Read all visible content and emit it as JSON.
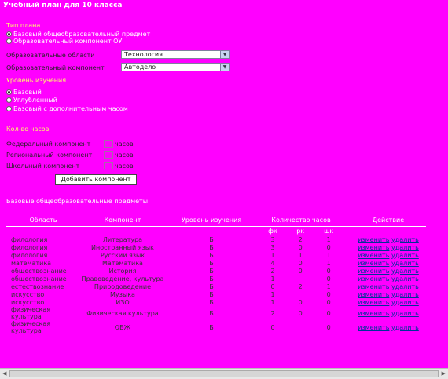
{
  "page": {
    "title": "Учебный план для 10 класса"
  },
  "plan_type": {
    "heading": "Тип плана",
    "options": [
      {
        "label": "Базовый общеобразовательный предмет",
        "selected": true
      },
      {
        "label": "Образовательный компонент ОУ",
        "selected": false
      }
    ]
  },
  "area_field": {
    "label": "Образовательные области",
    "value": "Технология"
  },
  "component_field": {
    "label": "Образовательный компонент",
    "value": "Автодело"
  },
  "study_level": {
    "heading": "Уровень изучения",
    "options": [
      {
        "label": "Базовый",
        "selected": true
      },
      {
        "label": "Углубленный",
        "selected": false
      },
      {
        "label": "Базовый с дополнительным часом",
        "selected": false
      }
    ]
  },
  "hours": {
    "heading": "Кол-во часов",
    "rows": [
      {
        "label": "Федеральный компонент",
        "unit": "часов"
      },
      {
        "label": "Региональный компонент",
        "unit": "часов"
      },
      {
        "label": "Школьный компонент",
        "unit": "часов"
      }
    ],
    "add_button": "Добавить компонент"
  },
  "table": {
    "heading": "Базовые общеобразовательные предметы",
    "columns": [
      "Область",
      "Компонент",
      "Уровень изучения",
      "Количество часов",
      "Действие"
    ],
    "sub_columns": [
      "фк",
      "рк",
      "шк"
    ],
    "edit_label": "изменить",
    "delete_label": "удалить",
    "rows": [
      {
        "area": "филология",
        "component": "Литература",
        "level": "Б",
        "fk": "3",
        "rk": "2",
        "shk": "1"
      },
      {
        "area": "филология",
        "component": "Иностранный язык",
        "level": "Б",
        "fk": "3",
        "rk": "0",
        "shk": "0"
      },
      {
        "area": "филология",
        "component": "Русский язык",
        "level": "Б",
        "fk": "1",
        "rk": "1",
        "shk": "1"
      },
      {
        "area": "математика",
        "component": "Математика",
        "level": "Б",
        "fk": "4",
        "rk": "0",
        "shk": "1"
      },
      {
        "area": "обществознание",
        "component": "История",
        "level": "Б",
        "fk": "2",
        "rk": "0",
        "shk": "0"
      },
      {
        "area": "обществознание",
        "component": "Правоведение, культура",
        "level": "Б",
        "fk": "1",
        "rk": "",
        "shk": "0"
      },
      {
        "area": "естествознание",
        "component": "Природоведение",
        "level": "Б",
        "fk": "0",
        "rk": "2",
        "shk": "1"
      },
      {
        "area": "искусство",
        "component": "Музыка",
        "level": "Б",
        "fk": "1",
        "rk": "",
        "shk": "0"
      },
      {
        "area": "искусство",
        "component": "ИЗО",
        "level": "Б",
        "fk": "1",
        "rk": "0",
        "shk": "0"
      },
      {
        "area": "физическая культура",
        "component": "Физическая культура",
        "level": "Б",
        "fk": "2",
        "rk": "0",
        "shk": "0"
      },
      {
        "area": "физическая культура",
        "component": "ОБЖ",
        "level": "Б",
        "fk": "0",
        "rk": "",
        "shk": "0"
      }
    ]
  }
}
